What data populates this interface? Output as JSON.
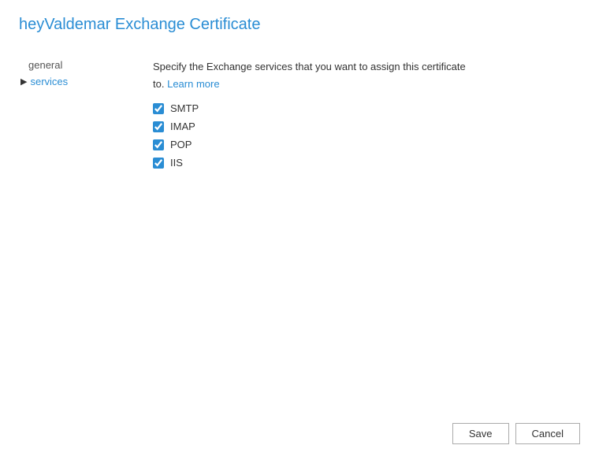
{
  "header": {
    "title": "heyValdemar Exchange Certificate"
  },
  "sidebar": {
    "general_label": "general",
    "services_label": "services",
    "arrow": "▶"
  },
  "main": {
    "description_line1": "Specify the Exchange services that you want to assign this certificate",
    "description_line2": "to.",
    "learn_more_label": "Learn more",
    "services": [
      {
        "id": "smtp",
        "label": "SMTP",
        "checked": true
      },
      {
        "id": "imap",
        "label": "IMAP",
        "checked": true
      },
      {
        "id": "pop",
        "label": "POP",
        "checked": true
      },
      {
        "id": "iis",
        "label": "IIS",
        "checked": true
      }
    ]
  },
  "footer": {
    "save_label": "Save",
    "cancel_label": "Cancel"
  }
}
